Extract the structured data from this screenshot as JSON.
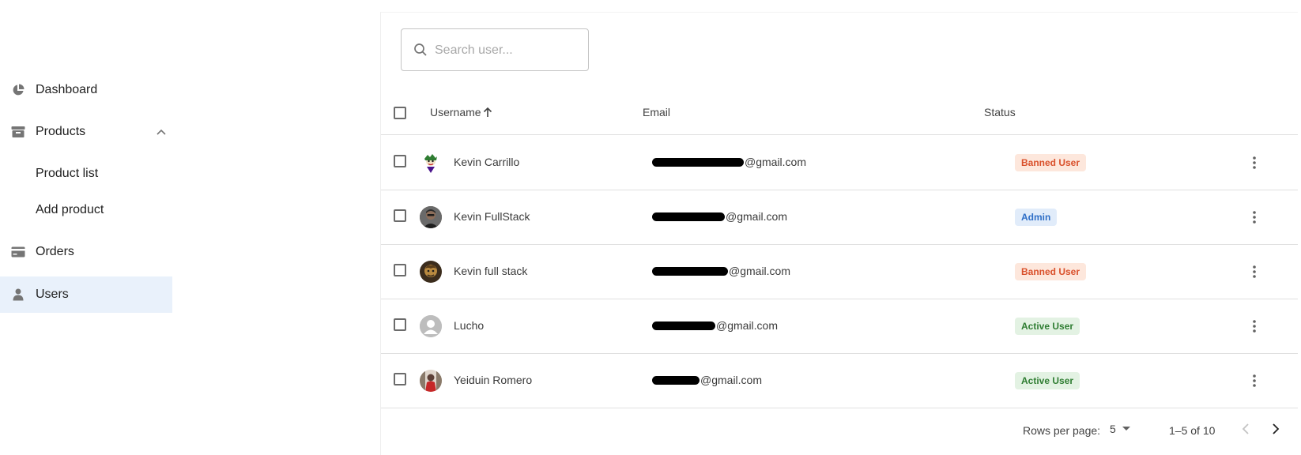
{
  "sidebar": {
    "items": [
      {
        "label": "Dashboard",
        "icon": "pie-chart-icon"
      },
      {
        "label": "Products",
        "icon": "archive-box-icon",
        "expanded": true,
        "children": [
          {
            "label": "Product list"
          },
          {
            "label": "Add product"
          }
        ]
      },
      {
        "label": "Orders",
        "icon": "credit-card-icon"
      },
      {
        "label": "Users",
        "icon": "person-icon",
        "active": true
      }
    ]
  },
  "search": {
    "placeholder": "Search user..."
  },
  "table": {
    "columns": {
      "username": "Username",
      "email": "Email",
      "status": "Status"
    },
    "sort": {
      "column": "username",
      "direction": "asc"
    },
    "rows": [
      {
        "username": "Kevin Carrillo",
        "email_visible": "@gmail.com",
        "status": "Banned User",
        "status_type": "banned"
      },
      {
        "username": "Kevin FullStack",
        "email_visible": "@gmail.com",
        "status": "Admin",
        "status_type": "admin"
      },
      {
        "username": "Kevin full stack",
        "email_visible": "@gmail.com",
        "status": "Banned User",
        "status_type": "banned"
      },
      {
        "username": "Lucho",
        "email_visible": "@gmail.com",
        "status": "Active User",
        "status_type": "active"
      },
      {
        "username": "Yeiduin Romero",
        "email_visible": "@gmail.com",
        "status": "Active User",
        "status_type": "active"
      }
    ]
  },
  "pagination": {
    "rows_per_page_label": "Rows per page:",
    "rows_per_page": "5",
    "range": "1–5 of 10"
  },
  "colors": {
    "active_nav_bg": "#e9f1fb",
    "banned_bg": "#fde7dc",
    "banned_text": "#d9502b",
    "admin_bg": "#e1ecfa",
    "admin_text": "#2f6fc7",
    "active_bg": "#e3f2e3",
    "active_text": "#2f7d32"
  }
}
